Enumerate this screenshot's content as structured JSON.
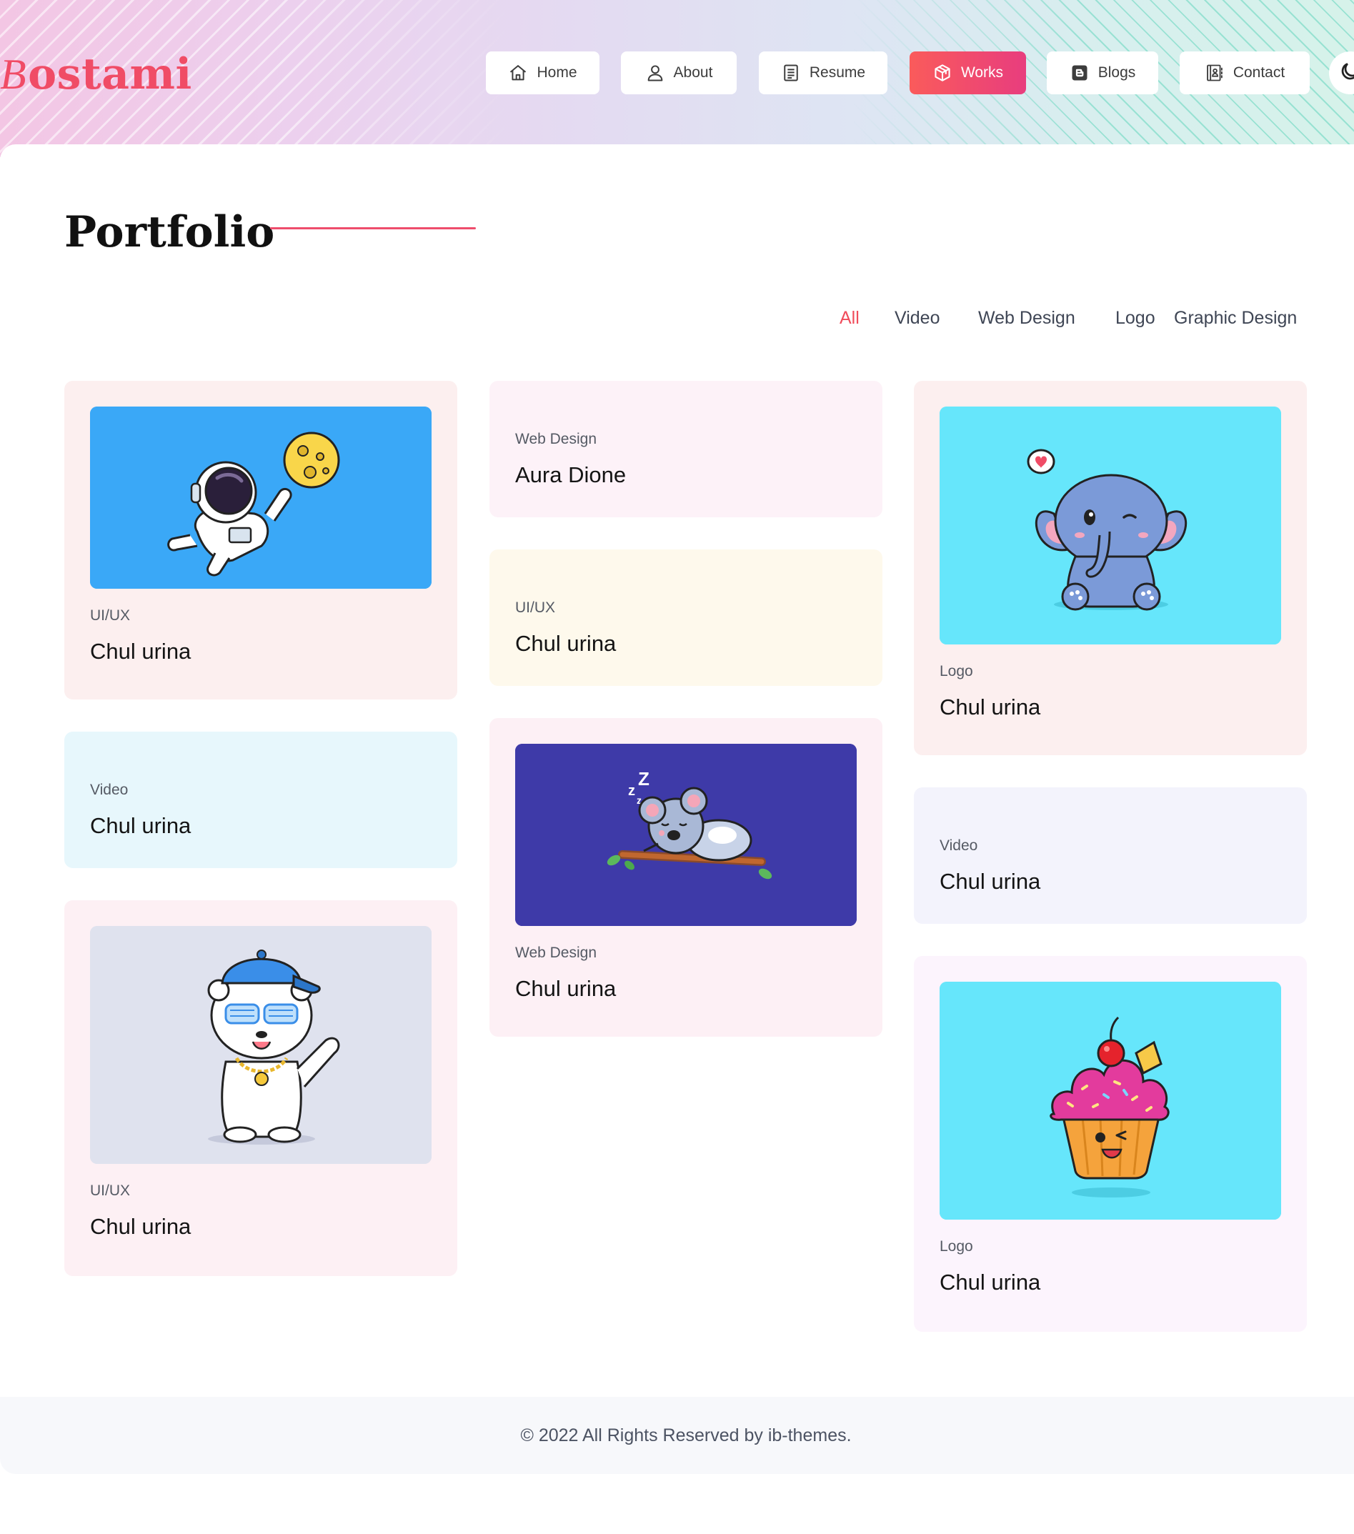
{
  "brand": {
    "logo_first_letter": "B",
    "logo_rest": "ostami",
    "accent_color": "#f04c66"
  },
  "nav": {
    "items": [
      {
        "label": "Home",
        "icon": "home-icon"
      },
      {
        "label": "About",
        "icon": "user-icon"
      },
      {
        "label": "Resume",
        "icon": "document-icon"
      },
      {
        "label": "Works",
        "icon": "cube-icon",
        "active": true
      },
      {
        "label": "Blogs",
        "icon": "blog-icon"
      },
      {
        "label": "Contact",
        "icon": "contact-book-icon"
      }
    ],
    "theme_toggle_icon": "moon-icon"
  },
  "page": {
    "title": "Portfolio"
  },
  "filters": {
    "items": [
      "All",
      "Video",
      "Web Design",
      "Logo",
      "Graphic Design"
    ],
    "active": "All",
    "active_color": "#f04c5b"
  },
  "portfolio": {
    "items": [
      {
        "category": "UI/UX",
        "title": "Chul urina",
        "image": "astronaut-moon-illustration",
        "bg": "#fcefef",
        "thumb_bg": "#3aa8f7"
      },
      {
        "category": "Video",
        "title": "Chul urina",
        "bg": "#e7f7fc"
      },
      {
        "category": "UI/UX",
        "title": "Chul urina",
        "image": "polar-bear-dab-illustration",
        "bg": "#fdf0f4",
        "thumb_bg": "#dfe2ee"
      },
      {
        "category": "Web Design",
        "title": "Aura Dione",
        "bg": "#fdf2f8"
      },
      {
        "category": "UI/UX",
        "title": "Chul urina",
        "bg": "#fef9ec"
      },
      {
        "category": "Web Design",
        "title": "Chul urina",
        "image": "sleeping-koala-illustration",
        "bg": "#fdf0f5",
        "thumb_bg": "#3e3aa8"
      },
      {
        "category": "Logo",
        "title": "Chul urina",
        "image": "elephant-wink-illustration",
        "bg": "#fcefef",
        "thumb_bg": "#66e6fb"
      },
      {
        "category": "Video",
        "title": "Chul urina",
        "bg": "#f3f3fc"
      },
      {
        "category": "Logo",
        "title": "Chul urina",
        "image": "cupcake-illustration",
        "bg": "#fcf4fd",
        "thumb_bg": "#66e6fb"
      }
    ]
  },
  "footer": {
    "text": "© 2022 All Rights Reserved by ib-themes."
  }
}
